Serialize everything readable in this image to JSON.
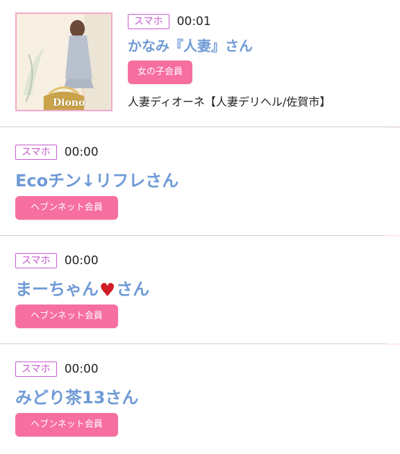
{
  "featured": {
    "badge": "スマホ",
    "time": "00:01",
    "name": "かなみ『人妻』さん",
    "member_label": "女の子会員",
    "shop": "人妻ディオーネ【人妻デリヘル/佐賀市】",
    "thumb_logo": "Diono"
  },
  "entries": [
    {
      "badge": "スマホ",
      "time": "00:00",
      "name": "Ecoチン↓リフレさん",
      "member_label": "ヘブンネット会員"
    },
    {
      "badge": "スマホ",
      "time": "00:00",
      "name_pre": "まーちゃん",
      "name_post": "さん",
      "heart": "♥",
      "member_label": "ヘブンネット会員"
    },
    {
      "badge": "スマホ",
      "time": "00:00",
      "name": "みどり茶13さん",
      "member_label": "ヘブンネット会員"
    }
  ],
  "colors": {
    "accent_name": "#6f9ad6",
    "member_button": "#f66fa0",
    "badge_border": "#c65bd0",
    "side_rail": "#ffe9ee",
    "heart": "#d01c24"
  }
}
